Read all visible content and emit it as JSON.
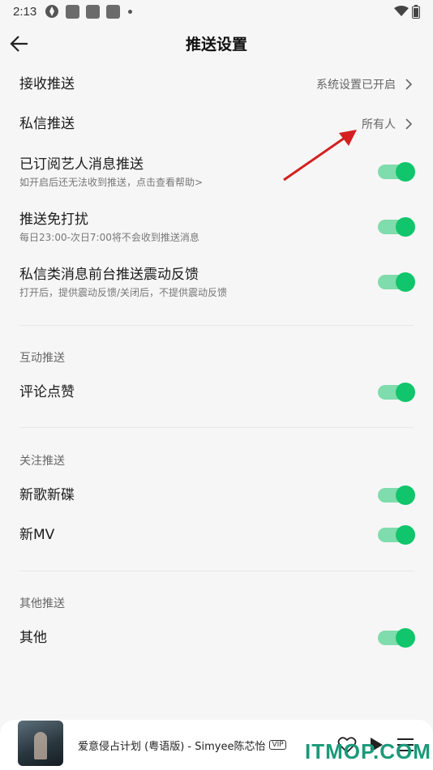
{
  "status": {
    "time": "2:13"
  },
  "header": {
    "title": "推送设置"
  },
  "settings": {
    "receive_push": {
      "label": "接收推送",
      "value": "系统设置已开启"
    },
    "dm_push": {
      "label": "私信推送",
      "value": "所有人"
    },
    "artist_push": {
      "label": "已订阅艺人消息推送",
      "sub": "如开启后还无法收到推送，点击查看帮助>",
      "on": true
    },
    "dnd": {
      "label": "推送免打扰",
      "sub": "每日23:00-次日7:00将不会收到推送消息",
      "on": true
    },
    "dm_vibrate": {
      "label": "私信类消息前台推送震动反馈",
      "sub": "打开后，提供震动反馈/关闭后，不提供震动反馈",
      "on": true
    }
  },
  "sections": {
    "interaction": {
      "title": "互动推送",
      "items": [
        {
          "label": "评论点赞",
          "on": true
        }
      ]
    },
    "follow": {
      "title": "关注推送",
      "items": [
        {
          "label": "新歌新碟",
          "on": true
        },
        {
          "label": "新MV",
          "on": true
        }
      ]
    },
    "other": {
      "title": "其他推送",
      "items": [
        {
          "label": "其他",
          "on": true
        }
      ]
    }
  },
  "player": {
    "song": "爱意侵占计划 (粤语版) - Simyee陈芯怡",
    "badge": "VIP"
  },
  "watermark": {
    "text": "ITMOP.COM"
  },
  "colors": {
    "toggle_track": "#7fdcac",
    "toggle_knob": "#10c56b",
    "annotation_arrow": "#d42020"
  }
}
